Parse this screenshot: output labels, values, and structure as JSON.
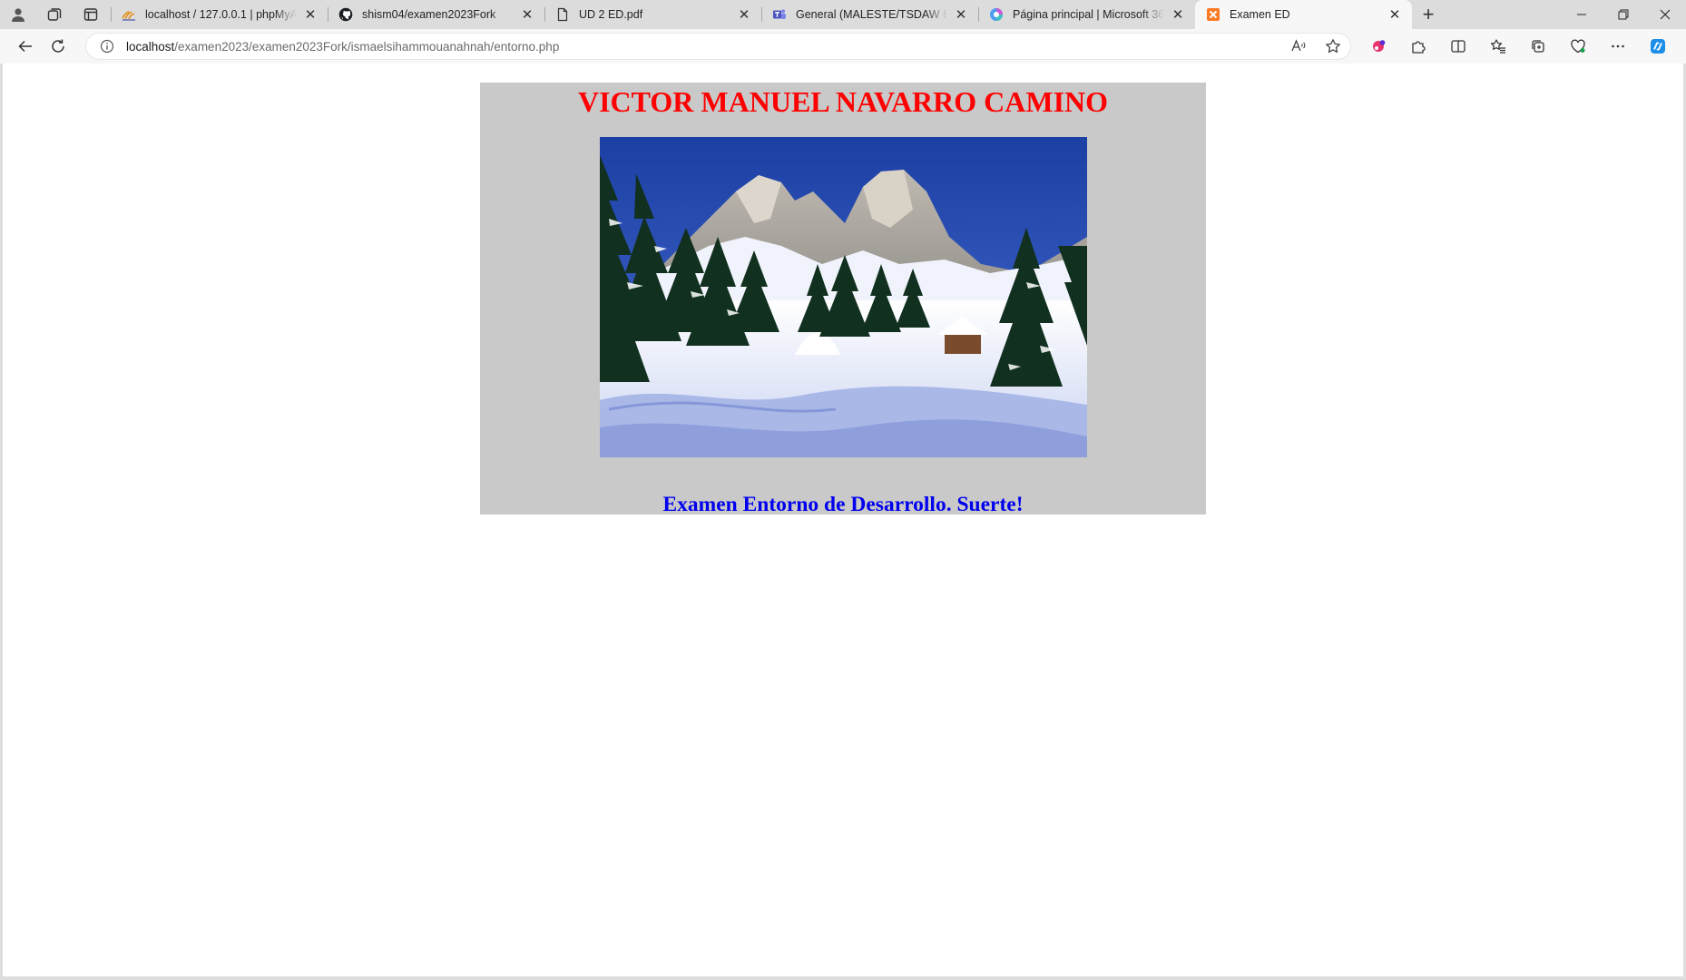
{
  "tabs": [
    {
      "title": "localhost / 127.0.0.1 | phpMyAdmin",
      "icon": "phpmyadmin-icon"
    },
    {
      "title": "shism04/examen2023Fork",
      "icon": "github-icon"
    },
    {
      "title": "UD 2 ED.pdf",
      "icon": "document-icon"
    },
    {
      "title": "General (MALESTE/TSDAW Entorno)",
      "icon": "teams-icon"
    },
    {
      "title": "Página principal | Microsoft 365",
      "icon": "microsoft365-icon"
    },
    {
      "title": "Examen ED",
      "icon": "xampp-icon",
      "active": true
    }
  ],
  "address": {
    "host": "localhost",
    "path": "/examen2023/examen2023Fork/ismaelsihammouanahnah/entorno.php"
  },
  "page": {
    "heading": "VICTOR MANUEL NAVARRO CAMINO",
    "image": "snowy-mountain-landscape",
    "footer": "Examen Entorno de Desarrollo. Suerte!",
    "box_color": "#c9c9c9",
    "heading_color": "#ff0000",
    "footer_color": "#0000ee"
  }
}
